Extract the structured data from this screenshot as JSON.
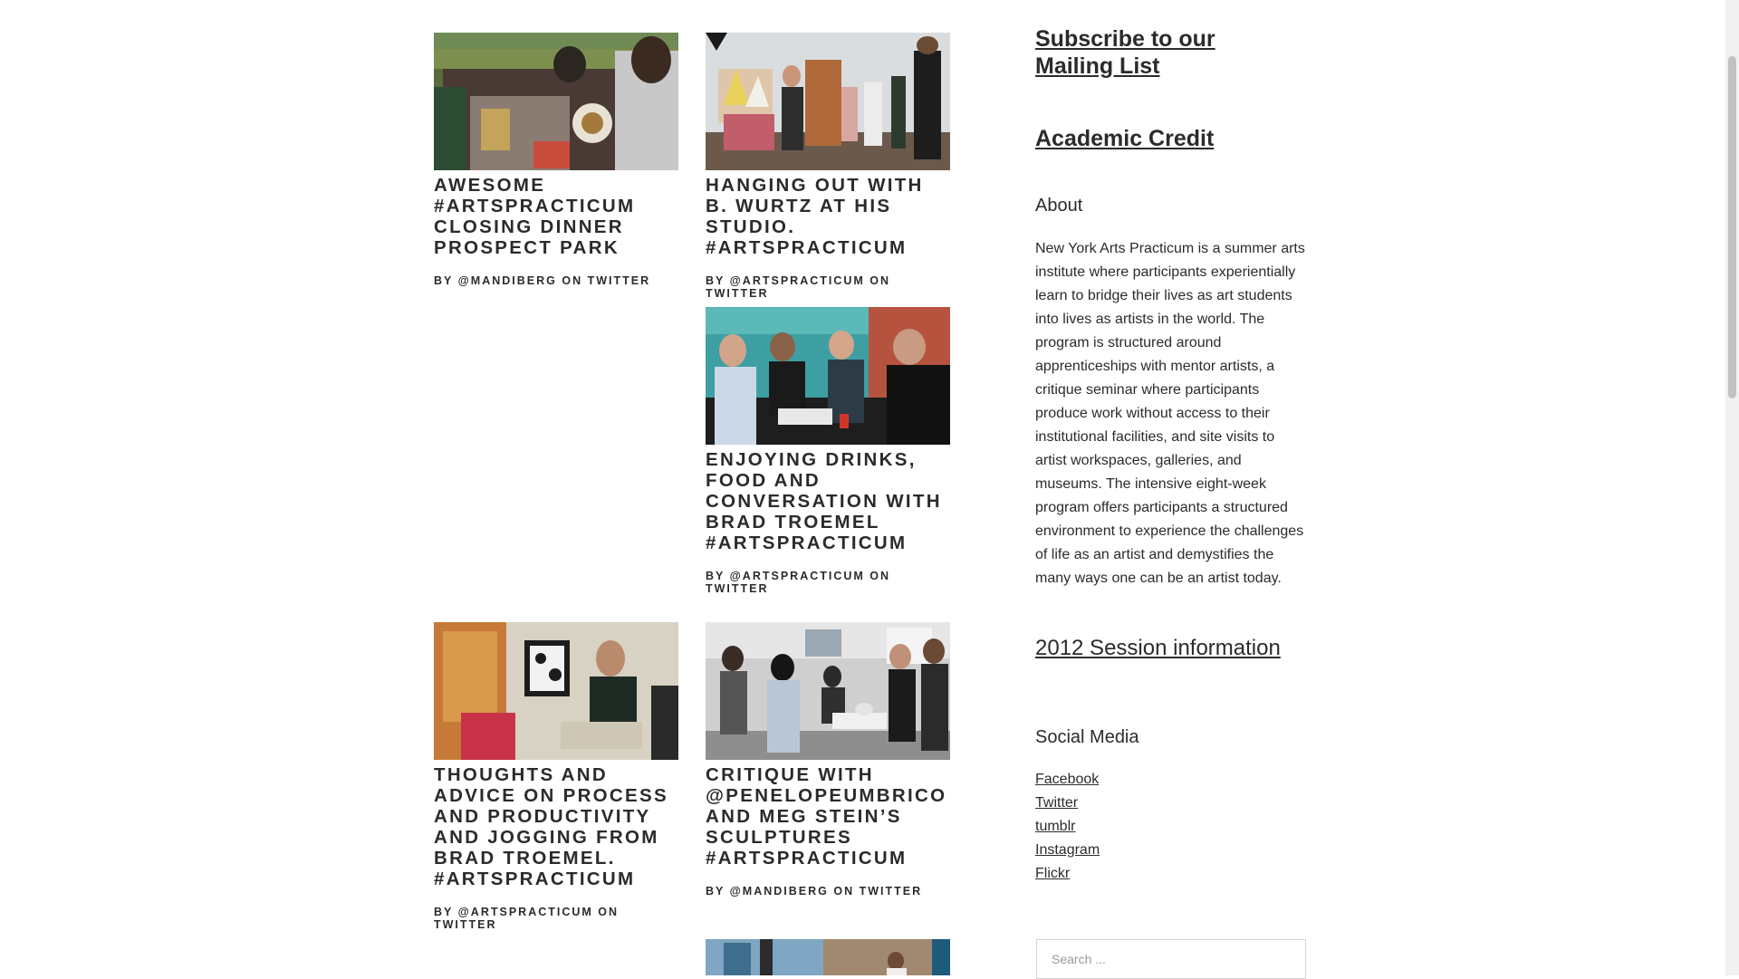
{
  "posts": [
    {
      "title": "AWESOME #ARTSPRACTICUM CLOSING DINNER PROSPECT PARK",
      "meta": "BY @MANDIBERG ON TWITTER",
      "image": "photo-picnic-dinner"
    },
    {
      "title": "HANGING OUT WITH B. WURTZ AT HIS STUDIO. #ARTSPRACTICUM",
      "meta": "BY @ARTSPRACTICUM ON TWITTER",
      "image": "photo-studio-visit"
    },
    {
      "title": "ENJOYING DRINKS, FOOD AND CONVERSATION WITH BRAD TROEMEL #ARTSPRACTICUM",
      "meta": "BY @ARTSPRACTICUM ON TWITTER",
      "image": "photo-drinks-patio"
    },
    {
      "title": "THOUGHTS AND ADVICE ON PROCESS AND PRODUCTIVITY AND JOGGING FROM BRAD TROEMEL. #ARTSPRACTICUM",
      "meta": "BY @ARTSPRACTICUM ON TWITTER",
      "image": "photo-man-seated"
    },
    {
      "title": "CRITIQUE WITH @PENELOPEUMBRICO AND MEG STEIN’S SCULPTURES #ARTSPRACTICUM",
      "meta": "BY @MANDIBERG ON TWITTER",
      "image": "photo-critique-group"
    },
    {
      "title": "",
      "meta": "",
      "image": "photo-classroom-partial"
    }
  ],
  "sidebar": {
    "subscribe": "Subscribe to our Mailing List",
    "academic_credit": "Academic Credit",
    "about_title": "About",
    "about_text": "New York Arts Practicum is a summer arts institute where participants experientially learn to bridge their lives as art students into lives as artists in the world. The program is structured around apprenticeships with mentor artists, a critique seminar where participants produce work without access to their institutional facilities, and site visits to artist workspaces, galleries, and museums. The intensive eight-week program offers participants a structured environment to experience the challenges of life as an artist and demystifies the many ways one can be an artist today.",
    "session_info": "2012 Session information",
    "social_title": "Social Media",
    "social_links": [
      "Facebook",
      "Twitter",
      "tumblr",
      "Instagram",
      "Flickr"
    ],
    "search_placeholder": "Search ..."
  },
  "colors": {
    "text": "#2b2b2b",
    "background": "#ffffff",
    "search_border": "#d4d4d4",
    "scroll_thumb": "#c1c1c1"
  }
}
